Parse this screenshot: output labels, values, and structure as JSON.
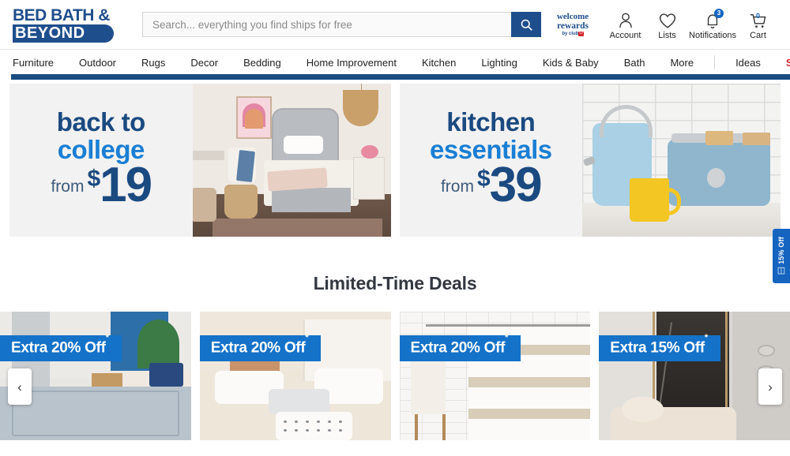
{
  "header": {
    "logo_line1": "BED BATH &",
    "logo_line2": "BEYOND",
    "search": {
      "placeholder": "Search... everything you find ships for free",
      "value": "",
      "button_icon": "search-icon"
    },
    "rewards": {
      "line1": "welcome",
      "line2": "rewards",
      "line3_prefix": "by club",
      "line3_chip": "O"
    },
    "actions": [
      {
        "label": "Account",
        "icon": "person-icon",
        "badge": ""
      },
      {
        "label": "Lists",
        "icon": "heart-icon",
        "badge": ""
      },
      {
        "label": "Notifications",
        "icon": "bell-icon",
        "badge": "3"
      },
      {
        "label": "Cart",
        "icon": "cart-icon",
        "badge": "0"
      }
    ]
  },
  "nav": {
    "items": [
      "Furniture",
      "Outdoor",
      "Rugs",
      "Decor",
      "Bedding",
      "Home Improvement",
      "Kitchen",
      "Lighting",
      "Kids & Baby",
      "Bath",
      "More"
    ],
    "right_items": [
      {
        "label": "Ideas",
        "sale": false
      },
      {
        "label": "Sales & Deals",
        "sale": true
      }
    ]
  },
  "banners": [
    {
      "line1": "back to",
      "line2": "college",
      "from": "from",
      "dollar": "$",
      "amount": "19",
      "image_alt": "dorm-bedroom-scene"
    },
    {
      "line1": "kitchen",
      "line2": "essentials",
      "from": "from",
      "dollar": "$",
      "amount": "39",
      "image_alt": "kitchen-kettle-toaster-scene"
    }
  ],
  "coupon_tab": {
    "text": "15% Off",
    "icon": "coupon-tag-icon"
  },
  "deals": {
    "title": "Limited-Time Deals",
    "prev_icon": "chevron-left-icon",
    "next_icon": "chevron-right-icon",
    "cards": [
      {
        "badge": "Extra 20% Off",
        "asterisk": "*",
        "image_alt": "area-rug-living-room"
      },
      {
        "badge": "Extra 20% Off",
        "asterisk": "*",
        "image_alt": "white-bedding-pillows"
      },
      {
        "badge": "Extra 20% Off",
        "asterisk": "*",
        "image_alt": "striped-shower-curtain"
      },
      {
        "badge": "Extra 15% Off",
        "asterisk": "*",
        "image_alt": "marble-shower-bath"
      }
    ]
  },
  "colors": {
    "brand_navy": "#1f4e8c",
    "brand_blue": "#1472c9",
    "sale_red": "#d3262c",
    "banner_bg": "#f2f2f2"
  }
}
